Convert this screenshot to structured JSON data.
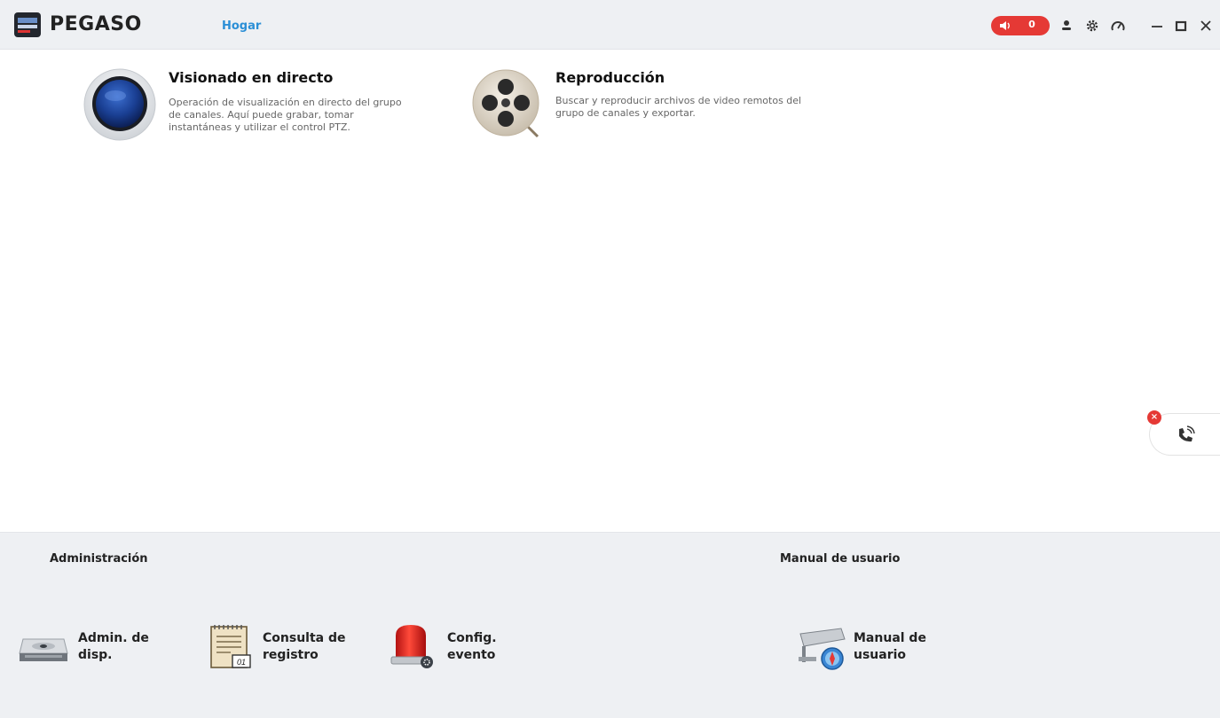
{
  "header": {
    "app_title": "PEGASO",
    "nav_home": "Hogar",
    "alarm_count": "0",
    "icons": [
      "user-icon",
      "gear-icon",
      "gauge-icon",
      "minimize-icon",
      "maximize-icon",
      "close-icon"
    ],
    "colors": {
      "accent": "#2b8fd6",
      "alarm": "#e53935"
    }
  },
  "modules": [
    {
      "title": "Visionado en directo",
      "desc_lines": [
        "Operación de visualización en directo del grupo",
        "de canales. Aquí puede grabar, tomar",
        "instantáneas y utilizar el control PTZ."
      ],
      "icon": "live-view-icon"
    },
    {
      "title": "Reproducción",
      "desc_lines": [
        "Buscar y reproducir archivos de video remotos del",
        "grupo de canales y exportar."
      ],
      "icon": "playback-reel-icon"
    }
  ],
  "bottom": {
    "admin_title": "Administración",
    "manual_title": "Manual de usuario",
    "tools": [
      {
        "line1": "Admin. de",
        "line2": "disp.",
        "icon": "device-manager-icon"
      },
      {
        "line1": "Consulta de",
        "line2": "registro",
        "icon": "log-query-icon"
      },
      {
        "line1": "Config.",
        "line2": "evento",
        "icon": "event-config-icon"
      },
      {
        "line1": "Manual de",
        "line2": "usuario",
        "icon": "user-manual-icon"
      }
    ]
  }
}
